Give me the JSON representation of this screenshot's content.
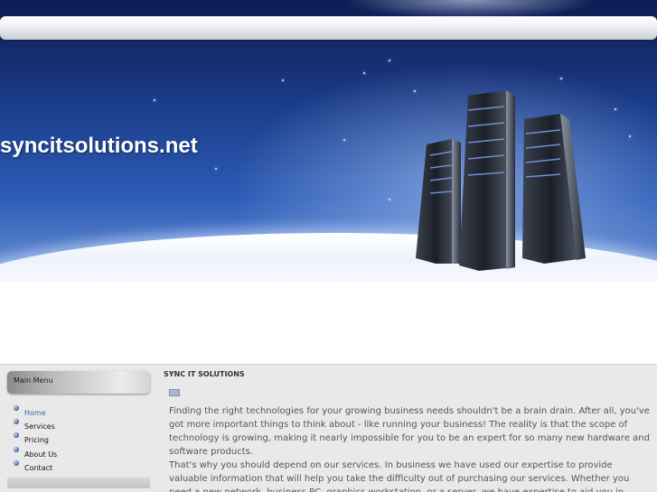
{
  "header": {
    "site_title": "syncitsolutions.net"
  },
  "sidebar": {
    "menu_title": "Main Menu",
    "items": [
      {
        "label": "Home",
        "active": true
      },
      {
        "label": "Services",
        "active": false
      },
      {
        "label": "Pricing",
        "active": false
      },
      {
        "label": "About Us",
        "active": false
      },
      {
        "label": "Contact",
        "active": false
      }
    ],
    "bullet_icon": "round-bullet-icon"
  },
  "main": {
    "heading": "SYNC IT SOLUTIONS",
    "icon": "mail-icon",
    "paragraphs": [
      "Finding the right technologies for your growing business needs shouldn't be a brain drain. After all, you've got more important things to think about - like running your business! The reality is that the scope of technology is growing, making it nearly impossible for you to be an expert for so many new hardware and software products.",
      "That's why you should depend on our services. In business we have used our expertise to provide valuable information that will help you take the difficulty out of purchasing our services. Whether you need a new network, business PC, graphics workstation, or a server, we have expertise to aid you in making an"
    ]
  },
  "colors": {
    "banner_dark": "#0d1d52",
    "banner_light": "#6d93d4",
    "menu_active": "#3a64b0",
    "body_text": "#555555",
    "content_bg": "#e9e9e9"
  }
}
